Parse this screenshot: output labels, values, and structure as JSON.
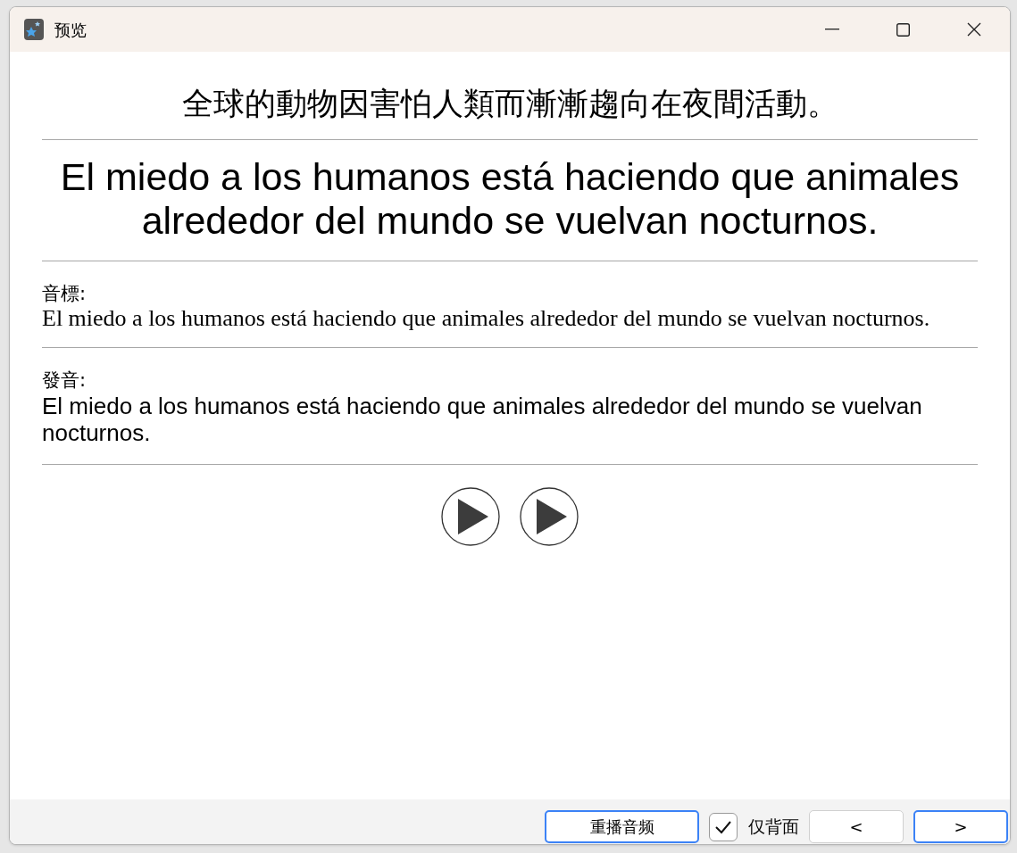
{
  "window": {
    "title": "预览"
  },
  "front": {
    "text": "全球的動物因害怕人類而漸漸趨向在夜間活動。"
  },
  "back": {
    "text": "El miedo a los humanos está haciendo que animales alrededor del mundo se vuelvan nocturnos."
  },
  "sections": [
    {
      "label": "音標:",
      "text": "El miedo a los humanos está haciendo que animales alrededor del mundo se vuelvan nocturnos.",
      "kind": "serif"
    },
    {
      "label": "發音:",
      "text": "El miedo a los humanos está haciendo que animales alrededor del mundo se vuelvan nocturnos.",
      "kind": "sans"
    }
  ],
  "play_buttons": [
    {
      "kind": "play"
    },
    {
      "kind": "play"
    }
  ],
  "footer": {
    "replay": {
      "label": "重播音频",
      "highlighted": true
    },
    "back_only": {
      "label": "仅背面",
      "checked": true
    },
    "nav": [
      {
        "label": "<",
        "highlighted": false
      },
      {
        "label": ">",
        "highlighted": true
      }
    ]
  }
}
